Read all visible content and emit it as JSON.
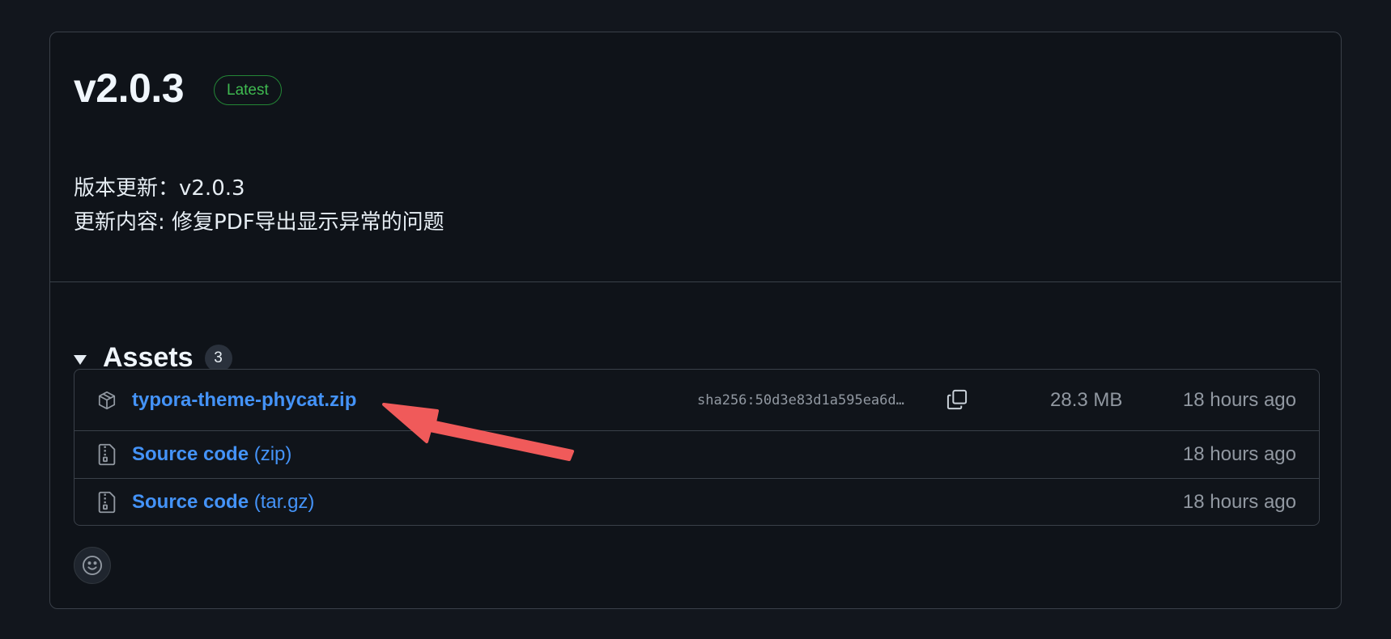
{
  "release": {
    "version": "v2.0.3",
    "badge": "Latest",
    "notes": [
      "版本更新：v2.0.3",
      "更新内容: 修复PDF导出显示异常的问题"
    ]
  },
  "assets": {
    "title": "Assets",
    "count": "3",
    "items": [
      {
        "name": "typora-theme-phycat.zip",
        "sha": "sha256:50d3e83d1a595ea6d…",
        "size": "28.3 MB",
        "time": "18 hours ago",
        "icon": "package-icon"
      },
      {
        "name": "Source code",
        "suffix": "(zip)",
        "time": "18 hours ago",
        "icon": "file-zip-icon"
      },
      {
        "name": "Source code",
        "suffix": "(tar.gz)",
        "time": "18 hours ago",
        "icon": "file-zip-icon"
      }
    ]
  },
  "colors": {
    "background": "#12161d",
    "link": "#4493f8",
    "badge_green": "#3fb950",
    "annotation_arrow": "#f05a5a"
  }
}
